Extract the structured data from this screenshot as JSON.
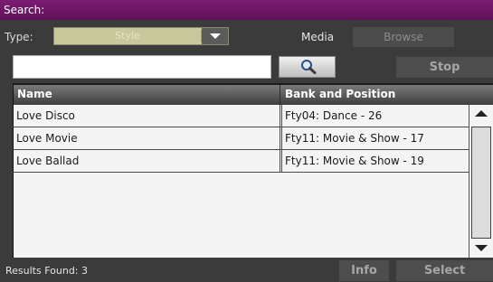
{
  "window": {
    "title": "Search:"
  },
  "filters": {
    "type_label": "Type:",
    "type_value": "Style",
    "media_label": "Media",
    "browse_label": "Browse"
  },
  "search": {
    "query": "",
    "stop_label": "Stop",
    "icon": "magnifier-icon"
  },
  "table": {
    "columns": [
      "Name",
      "Bank and Position"
    ],
    "rows": [
      {
        "name": "Love Disco",
        "bank": "Fty04: Dance - 26"
      },
      {
        "name": "Love Movie",
        "bank": "Fty11: Movie & Show - 17"
      },
      {
        "name": "Love Ballad",
        "bank": "Fty11: Movie & Show - 19"
      }
    ]
  },
  "footer": {
    "results_text": "Results Found:  3",
    "info_label": "Info",
    "select_label": "Select"
  },
  "colors": {
    "titlebar": "#6a1a63",
    "background": "#3b3b3b",
    "type_field": "#c8c89c"
  }
}
